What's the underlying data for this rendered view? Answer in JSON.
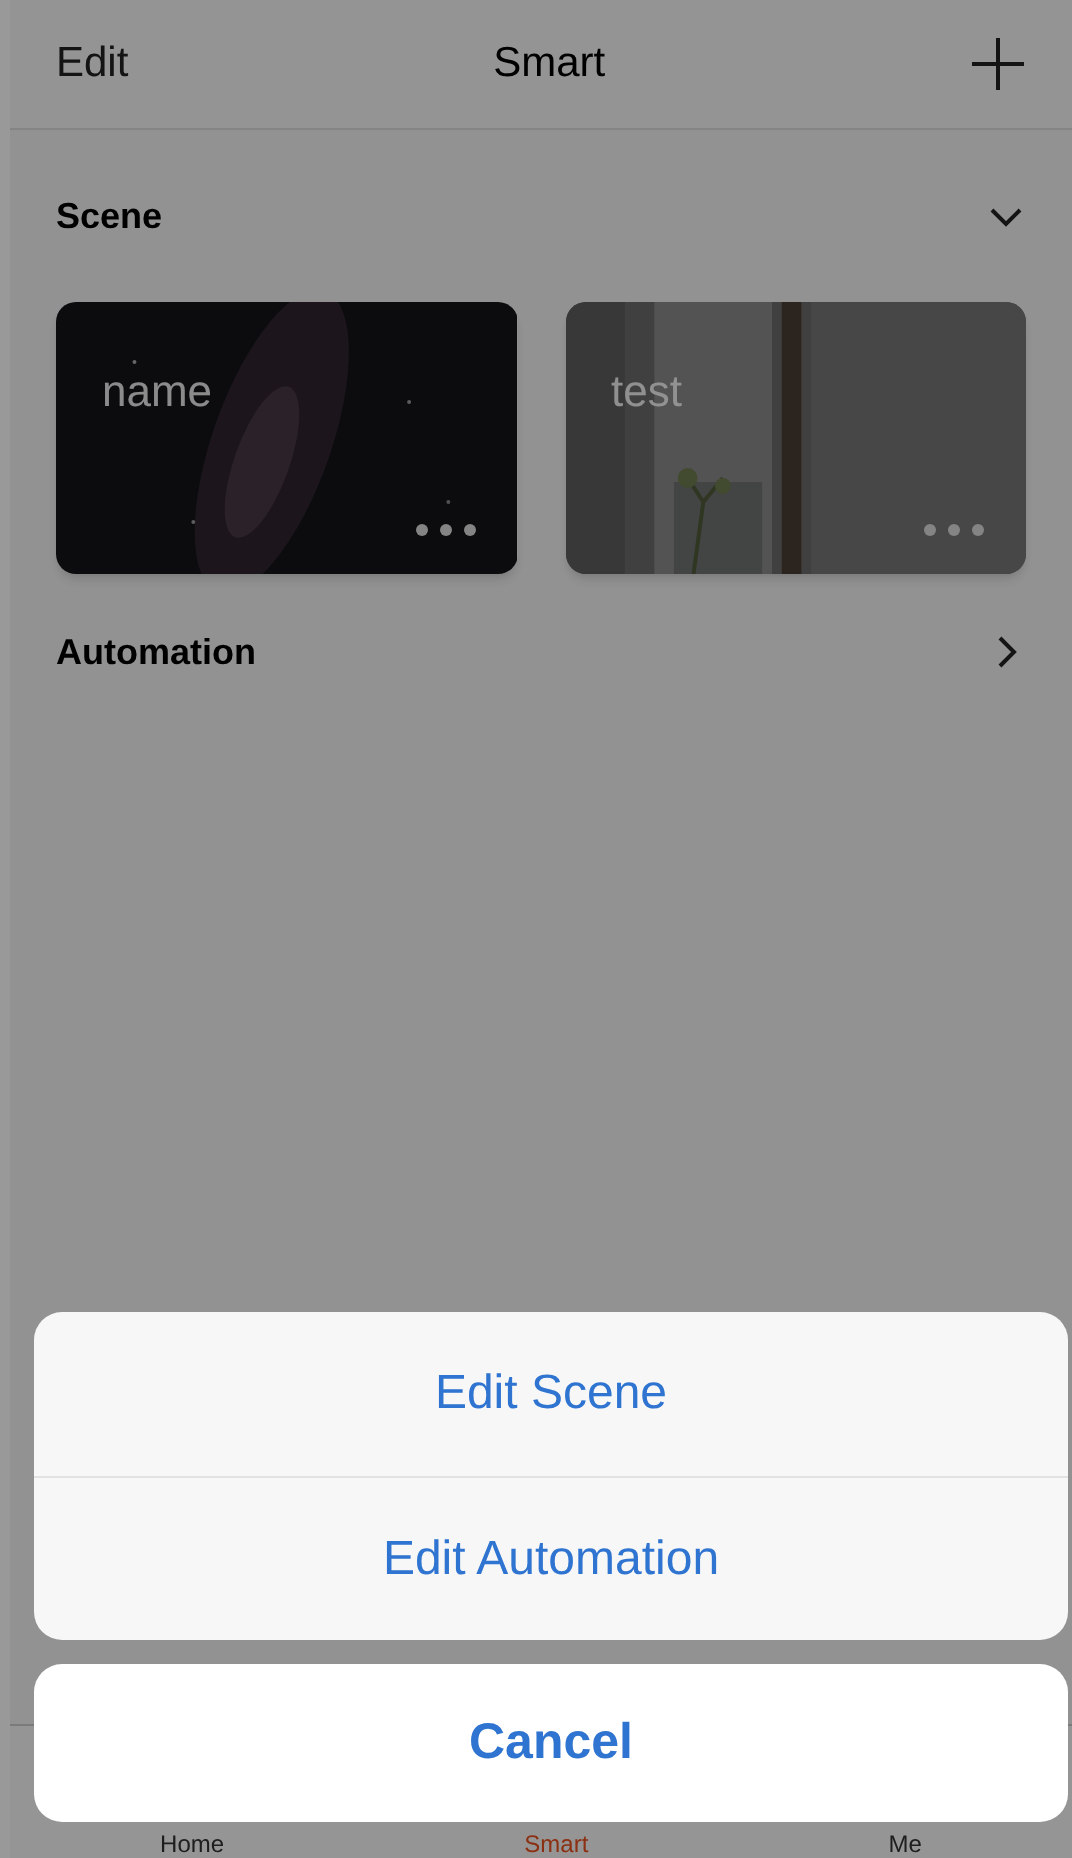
{
  "header": {
    "left": "Edit",
    "title": "Smart"
  },
  "sections": [
    {
      "title": "Scene",
      "expanded": true,
      "scenes": [
        {
          "name": "name",
          "kind": "picture"
        },
        {
          "name": "test",
          "kind": "picture"
        }
      ]
    },
    {
      "title": "Automation",
      "expanded": false
    }
  ],
  "tab_bar": [
    {
      "label": "Home",
      "selected": false
    },
    {
      "label": "Smart",
      "selected": true
    },
    {
      "label": "Me",
      "selected": false
    }
  ],
  "action_sheet": {
    "actions": [
      "Edit Scene",
      "Edit Automation"
    ],
    "cancel": "Cancel"
  }
}
